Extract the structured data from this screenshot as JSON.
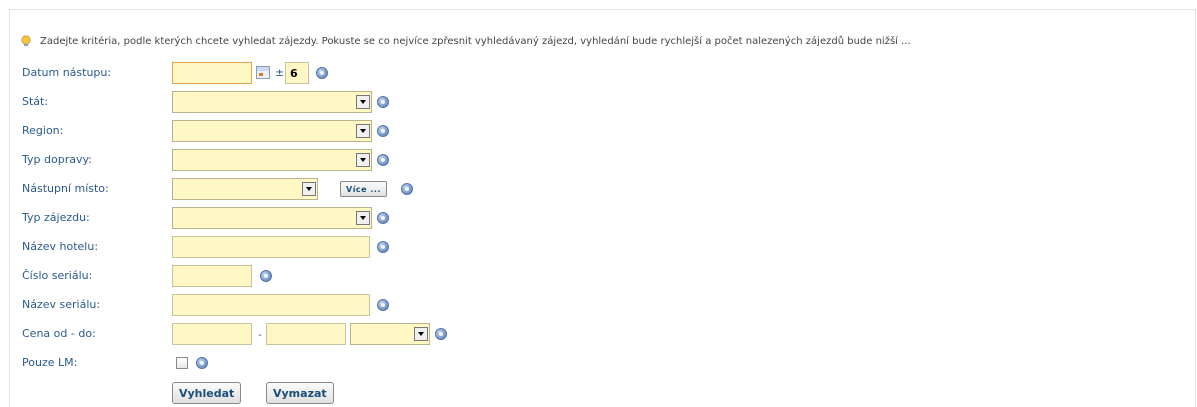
{
  "hint": "Zadejte kritéria, podle kterých chcete vyhledat zájezdy. Pokuste se co nejvíce zpřesnit vyhledávaný zájezd, vyhledání bude rychlejší a počet nalezených zájezdů bude nižší ...",
  "fields": {
    "datum": {
      "label": "Datum nástupu:",
      "value": "",
      "plusminus": "±",
      "range_value": "6"
    },
    "stat": {
      "label": "Stát:",
      "selected": ""
    },
    "region": {
      "label": "Region:",
      "selected": ""
    },
    "typ_dopravy": {
      "label": "Typ dopravy:",
      "selected": ""
    },
    "nastupni_misto": {
      "label": "Nástupní místo:",
      "selected": "",
      "more_label": "Více ..."
    },
    "typ_zajezdu": {
      "label": "Typ zájezdu:",
      "selected": ""
    },
    "nazev_hotelu": {
      "label": "Název hotelu:",
      "value": ""
    },
    "cislo_serialu": {
      "label": "Číslo seriálu:",
      "value": ""
    },
    "nazev_serialu": {
      "label": "Název seriálu:",
      "value": ""
    },
    "cena": {
      "label": "Cena od - do:",
      "from": "",
      "separator": "-",
      "to": "",
      "currency": ""
    },
    "pouze_lm": {
      "label": "Pouze LM:",
      "checked": false
    }
  },
  "buttons": {
    "search": "Vyhledat",
    "clear": "Vymazat"
  },
  "icons": {
    "hint": "lightbulb-icon",
    "help": "help-question-icon",
    "calendar": "calendar-icon"
  },
  "colors": {
    "input_bg": "#fff8c4",
    "label": "#2a5a8c",
    "focus_border": "#e8a54b"
  }
}
